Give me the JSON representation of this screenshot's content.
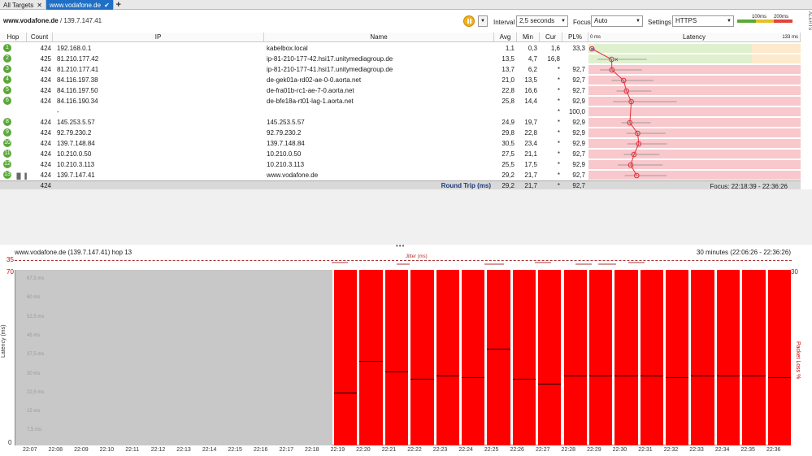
{
  "tabs": [
    {
      "label": "All Targets",
      "active": false
    },
    {
      "label": "www.vodafone.de",
      "active": true
    }
  ],
  "toolbar": {
    "target": "www.vodafone.de",
    "target_ip": "/ 139.7.147.41",
    "interval_label": "Interval",
    "interval_value": "2,5 seconds",
    "focus_label": "Focus",
    "focus_value": "Auto",
    "settings_label": "Settings",
    "settings_value": "HTTPS",
    "legend_100": "100ms",
    "legend_200": "200ms",
    "alerts_label": "ALERTS"
  },
  "colors": {
    "green": "#5ba839",
    "pink": "#f8c8cc",
    "lightgreen": "#dff0cf",
    "peach": "#fde9cc",
    "red": "#ff0000",
    "accent": "#1f6fc5"
  },
  "columns": {
    "hop": "Hop",
    "count": "Count",
    "ip": "IP",
    "name": "Name",
    "avg": "Avg",
    "min": "Min",
    "cur": "Cur",
    "pl": "PL%",
    "latency": "Latency",
    "lat_min": "0 ms",
    "lat_max": "133 ms"
  },
  "rows": [
    {
      "hop": "1",
      "count": "424",
      "ip": "192.168.0.1",
      "name": "kabelbox.local",
      "avg": "1,1",
      "min": "0,3",
      "cur": "1,6",
      "pl": "33,3"
    },
    {
      "hop": "2",
      "count": "425",
      "ip": "81.210.177.42",
      "name": "ip-81-210-177-42.hsi17.unitymediagroup.de",
      "avg": "13,5",
      "min": "4,7",
      "cur": "16,8",
      "pl": ""
    },
    {
      "hop": "3",
      "count": "424",
      "ip": "81.210.177.41",
      "name": "ip-81-210-177-41.hsi17.unitymediagroup.de",
      "avg": "13,7",
      "min": "6,2",
      "cur": "*",
      "pl": "92,7"
    },
    {
      "hop": "4",
      "count": "424",
      "ip": "84.116.197.38",
      "name": "de-gek01a-rd02-ae-0-0.aorta.net",
      "avg": "21,0",
      "min": "13,5",
      "cur": "*",
      "pl": "92,7"
    },
    {
      "hop": "5",
      "count": "424",
      "ip": "84.116.197.50",
      "name": "de-fra01b-rc1-ae-7-0.aorta.net",
      "avg": "22,8",
      "min": "16,6",
      "cur": "*",
      "pl": "92,7"
    },
    {
      "hop": "6",
      "count": "424",
      "ip": "84.116.190.34",
      "name": "de-bfe18a-rt01-lag-1.aorta.net",
      "avg": "25,8",
      "min": "14,4",
      "cur": "*",
      "pl": "92,9"
    },
    {
      "hop": "",
      "count": "",
      "ip": "-",
      "name": "",
      "avg": "",
      "min": "",
      "cur": "*",
      "pl": "100,0"
    },
    {
      "hop": "8",
      "count": "424",
      "ip": "145.253.5.57",
      "name": "145.253.5.57",
      "avg": "24,9",
      "min": "19,7",
      "cur": "*",
      "pl": "92,9"
    },
    {
      "hop": "9",
      "count": "424",
      "ip": "92.79.230.2",
      "name": "92.79.230.2",
      "avg": "29,8",
      "min": "22,8",
      "cur": "*",
      "pl": "92,9"
    },
    {
      "hop": "10",
      "count": "424",
      "ip": "139.7.148.84",
      "name": "139.7.148.84",
      "avg": "30,5",
      "min": "23,4",
      "cur": "*",
      "pl": "92,9"
    },
    {
      "hop": "11",
      "count": "424",
      "ip": "10.210.0.50",
      "name": "10.210.0.50",
      "avg": "27,5",
      "min": "21,1",
      "cur": "*",
      "pl": "92,7"
    },
    {
      "hop": "12",
      "count": "424",
      "ip": "10.210.3.113",
      "name": "10.210.3.113",
      "avg": "25,5",
      "min": "17,5",
      "cur": "*",
      "pl": "92,9"
    },
    {
      "hop": "13",
      "count": "424",
      "ip": "139.7.147.41",
      "name": "www.vodafone.de",
      "avg": "29,2",
      "min": "21,7",
      "cur": "*",
      "pl": "92,7"
    }
  ],
  "summary": {
    "count": "424",
    "label": "Round Trip (ms)",
    "avg": "29,2",
    "min": "21,7",
    "cur": "*",
    "pl": "92,7",
    "focus": "Focus: 22:18:39 - 22:36:26"
  },
  "lower": {
    "title": "www.vodafone.de (139.7.147.41) hop 13",
    "range": "30 minutes (22:06:26 - 22:36:26)",
    "jitter_label": "Jitter (ms)",
    "jitter_max": "35",
    "y_max": "70",
    "y_min": "0",
    "pl_max": "30",
    "ylabel": "Latency (ms)",
    "ylabel_right": "Packet Loss %",
    "y_ticks": [
      "67,5 ms",
      "60 ms",
      "52,5 ms",
      "45 ms",
      "37,5 ms",
      "30 ms",
      "22,5 ms",
      "15 ms",
      "7,5 ms"
    ],
    "x_ticks": [
      "22:07",
      "22:08",
      "22:09",
      "22:10",
      "22:11",
      "22:12",
      "22:13",
      "22:14",
      "22:15",
      "22:16",
      "22:17",
      "22:18",
      "22:19",
      "22:20",
      "22:21",
      "22:22",
      "22:23",
      "22:24",
      "22:25",
      "22:26",
      "22:27",
      "22:28",
      "22:29",
      "22:30",
      "22:31",
      "22:32",
      "22:33",
      "22:34",
      "22:35",
      "22:36"
    ]
  }
}
